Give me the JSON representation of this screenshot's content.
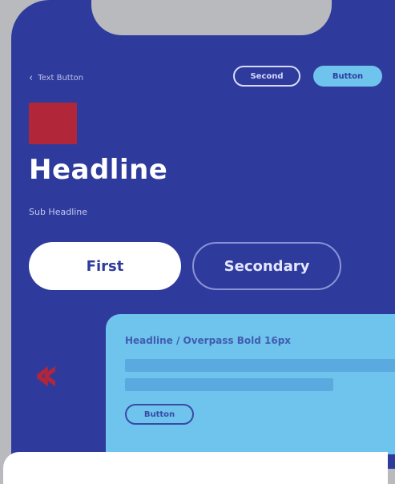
{
  "header": {
    "back_label": "Text Button",
    "second_label": "Second",
    "button_label": "Button"
  },
  "hero": {
    "headline": "Headline",
    "subheadline": "Sub Headline"
  },
  "segmented": {
    "first_label": "First",
    "secondary_label": "Secondary"
  },
  "card": {
    "title": "Headline / Overpass Bold 16px",
    "button_label": "Button"
  },
  "colors": {
    "background": "#2f3b9c",
    "accent": "#6ec4ec",
    "brand": "#b2263a",
    "frame": "#b9babd"
  },
  "icons": {
    "back": "chevron-left-icon",
    "carousel": "double-chevron-left-icon"
  }
}
